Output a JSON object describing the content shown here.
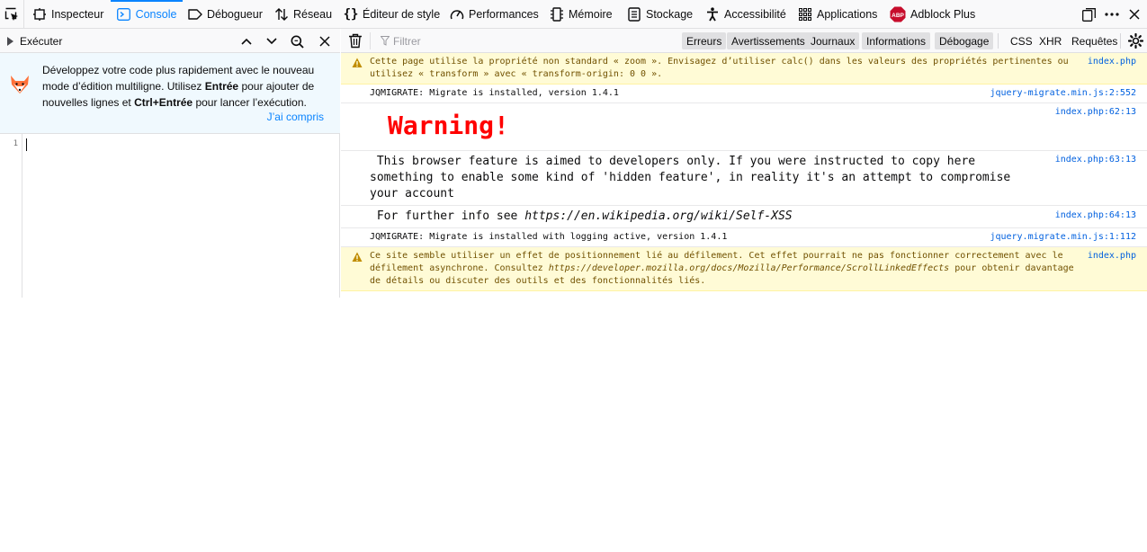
{
  "toolbar": {
    "tabs": [
      {
        "label": "Inspecteur",
        "icon": "inspector-icon"
      },
      {
        "label": "Console",
        "icon": "console-icon"
      },
      {
        "label": "Débogueur",
        "icon": "debugger-icon"
      },
      {
        "label": "Réseau",
        "icon": "network-icon"
      },
      {
        "label": "Éditeur de style",
        "icon": "style-editor-icon"
      },
      {
        "label": "Performances",
        "icon": "performance-icon"
      },
      {
        "label": "Mémoire",
        "icon": "memory-icon"
      },
      {
        "label": "Stockage",
        "icon": "storage-icon"
      },
      {
        "label": "Accessibilité",
        "icon": "accessibility-icon"
      },
      {
        "label": "Applications",
        "icon": "applications-icon"
      },
      {
        "label": "Adblock Plus",
        "icon": "abp-icon"
      }
    ],
    "selected_tab": "Console",
    "abp_badge": "ABP",
    "accent_color": "#0a84ff"
  },
  "editor": {
    "run_label": "Exécuter",
    "onboarding_text_1": "Développez votre code plus rapidement avec le nouveau mode d’édition multiligne. Utilisez ",
    "onboarding_bold_1": "Entrée",
    "onboarding_text_2": " pour ajouter de nouvelles lignes et ",
    "onboarding_bold_2": "Ctrl+Entrée",
    "onboarding_text_3": " pour lancer l’exécution.",
    "onboarding_ok": "J’ai compris",
    "line_number": "1"
  },
  "filter": {
    "placeholder": "Filtrer",
    "levels": [
      "Erreurs",
      "Avertissements",
      "Journaux",
      "Informations",
      "Débogage"
    ],
    "extra": [
      "CSS",
      "XHR",
      "Requêtes"
    ]
  },
  "messages": [
    {
      "type": "warning",
      "text": "Cette page utilise la propriété non standard « zoom ». Envisagez d’utiliser calc() dans les valeurs des propriétés pertinentes ou\nutilisez « transform » avec « transform-origin: 0 0 ».",
      "source": "index.php"
    },
    {
      "type": "log",
      "text": "JQMIGRATE: Migrate is installed, version 1.4.1",
      "source": "jquery-migrate.min.js:2:552"
    },
    {
      "type": "styled",
      "text": "Warning!",
      "source": "index.php:62:13"
    },
    {
      "type": "styled",
      "text": " This browser feature is aimed to developers only. If you were instructed to copy here\nsomething to enable some kind of 'hidden feature', in reality it's an attempt to compromise\nyour account",
      "source": "index.php:63:13"
    },
    {
      "type": "styled",
      "text_prefix": " For further info see ",
      "text_link": "https://en.wikipedia.org/wiki/Self-XSS",
      "source": "index.php:64:13"
    },
    {
      "type": "log",
      "text": "JQMIGRATE: Migrate is installed with logging active, version 1.4.1",
      "source": "jquery.migrate.min.js:1:112"
    },
    {
      "type": "warning",
      "text_prefix": "Ce site semble utiliser un effet de positionnement lié au défilement. Cet effet pourrait ne pas fonctionner correctement avec le\ndéfilement asynchrone. Consultez ",
      "text_link": "https://developer.mozilla.org/docs/Mozilla/Performance/ScrollLinkedEffects",
      "text_suffix": " pour obtenir davantage\nde détails ou discuter des outils et des fonctionnalités liés.",
      "source": "index.php"
    }
  ]
}
